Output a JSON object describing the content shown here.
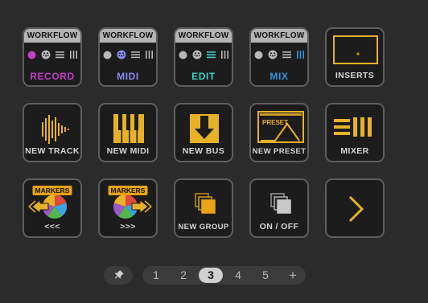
{
  "colors": {
    "accent_yellow": "#e8b12a",
    "record": "#c43fc4",
    "midi": "#8b8cf0",
    "edit": "#3ad1c4",
    "mix": "#2f95e0"
  },
  "workflow": {
    "header": "WORKFLOW",
    "record_label": "RECORD",
    "midi_label": "MIDI",
    "edit_label": "EDIT",
    "mix_label": "MIX"
  },
  "tiles": {
    "inserts": "INSERTS",
    "new_track": "NEW TRACK",
    "new_midi": "NEW MIDI",
    "new_bus": "NEW BUS",
    "new_preset": "NEW PRESET",
    "preset_caption": "PRESET",
    "mixer": "MIXER",
    "markers_badge": "MARKERS",
    "markers_prev": "<<<",
    "markers_next": ">>>",
    "new_group": "NEW GROUP",
    "on_off": "ON / OFF"
  },
  "pager": {
    "pages": [
      "1",
      "2",
      "3",
      "4",
      "5"
    ],
    "current": "3",
    "add": "+"
  }
}
